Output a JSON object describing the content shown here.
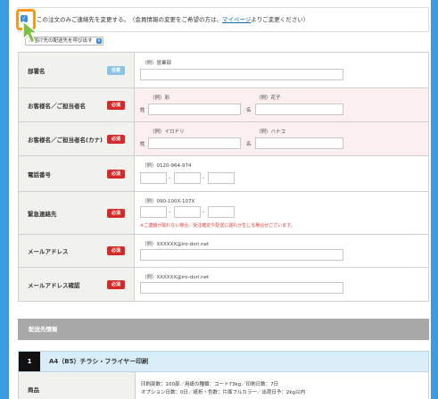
{
  "notice": {
    "text": "この注文のみご連絡先を変更する。　（会員情報の変更をご希望の方は、",
    "link": "マイページ",
    "text_after": "よりご変更ください）"
  },
  "select": {
    "value": "お届け先の配送先を呼び出す"
  },
  "form": {
    "company": {
      "label": "部署名",
      "badge": "任意",
      "example": "（例）営業部"
    },
    "name": {
      "label": "お客様名／ご担当者名",
      "badge": "必須",
      "ex_last": "（例）彩",
      "ex_first": "（例）花子",
      "last_label": "姓",
      "first_label": "名"
    },
    "kana": {
      "label": "お客様名／ご担当者名(カナ)",
      "badge": "必須",
      "ex_last": "（例）イロドリ",
      "ex_first": "（例）ハナコ",
      "last_label": "姓",
      "first_label": "名"
    },
    "phone": {
      "label": "電話番号",
      "badge": "必須",
      "example": "（例）0120-964-974",
      "sep": "-"
    },
    "emergency": {
      "label": "緊急連絡先",
      "badge": "必須",
      "example": "（例）090-100X-107X",
      "sep": "-",
      "warning": "※ご連絡が取れない場合、受注確定や配送に遅れが生じる場合がございます。"
    },
    "email": {
      "label": "メールアドレス",
      "badge": "必須",
      "example": "（例）XXXXXX@iro-dori.net"
    },
    "email_confirm": {
      "label": "メールアドレス確認",
      "badge": "必須",
      "example": "（例）XXXXXX@iro-dori.net"
    }
  },
  "section": {
    "title": "配送先情報"
  },
  "product": {
    "number": "1",
    "name": "A4（B5）チラシ・フライヤー印刷",
    "row_label": "商品",
    "line1": "印刷部数：100部／用紙の種類：コート73kg／印刷日数：7日",
    "line2": "オプション日数：0日／紙折・色数：片面フルカラー／出荷日予：2kg以内"
  },
  "colors": {
    "background": "#3d9be0",
    "required": "#d42a2a",
    "optional": "#8cc4e6",
    "highlight": "#f39a1c"
  }
}
